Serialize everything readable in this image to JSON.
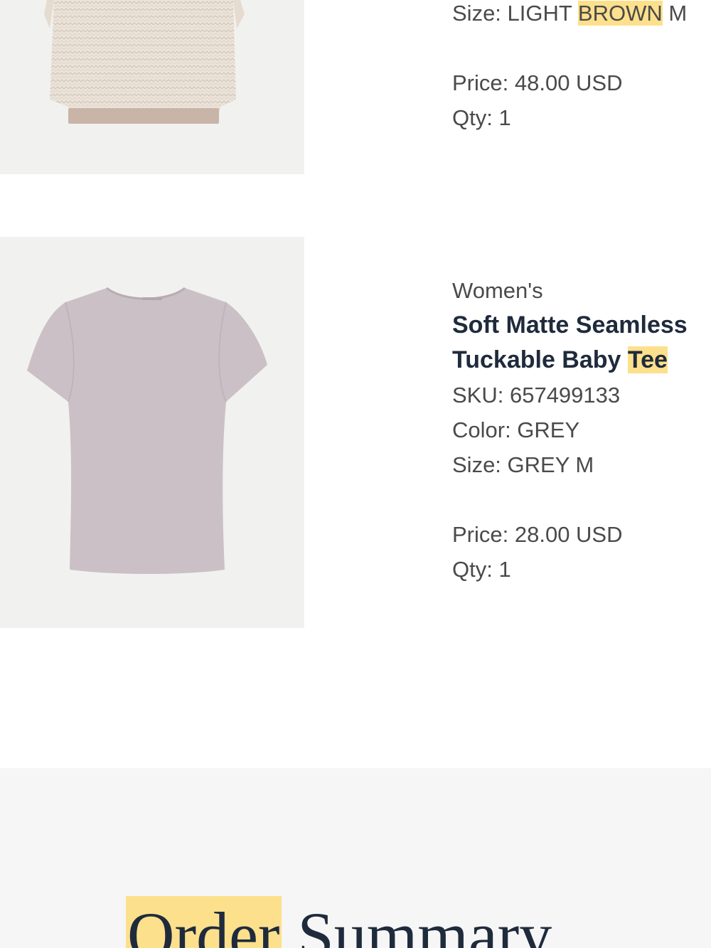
{
  "items": [
    {
      "size_label": "Size:",
      "size_prefix": "LIGHT",
      "size_highlight": "BROWN",
      "size_suffix": "M",
      "price": "Price: 48.00 USD",
      "qty": "Qty: 1",
      "image_icon": "knit-tee-image",
      "image_color": "#e3d8ce"
    },
    {
      "category": "Women's",
      "name_line1": "Soft Matte Seamless",
      "name_line2_prefix": "Tuckable Baby",
      "name_line2_highlight": "Tee",
      "sku": "SKU: 657499133",
      "color": "Color: GREY",
      "size": "Size: GREY M",
      "price": "Price: 28.00 USD",
      "qty": "Qty: 1",
      "image_icon": "tee-shirt-image",
      "image_color": "#cbc0c6"
    }
  ],
  "order_summary": {
    "title_highlight": "Order",
    "title_rest": "Summary"
  },
  "colors": {
    "highlight": "#fde08c",
    "heading": "#1f2b3c",
    "text": "#4a4a4a",
    "image_bg": "#f1f1f0",
    "summary_bg": "#f6f6f6"
  }
}
